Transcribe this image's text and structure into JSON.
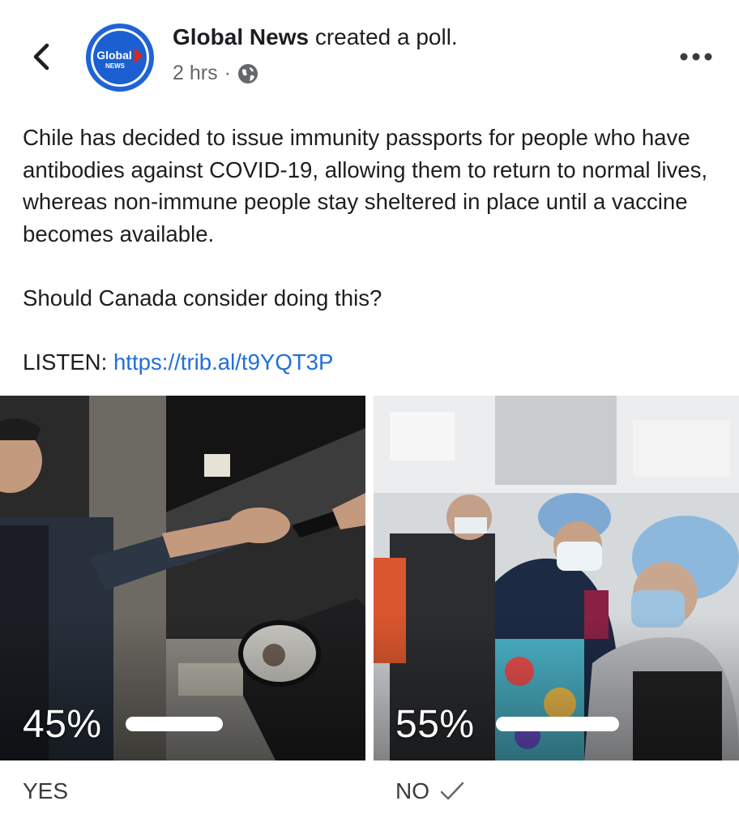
{
  "post": {
    "page_name": "Global News",
    "action_text": " created a poll.",
    "time": "2 hrs",
    "separator": "·",
    "avatar": {
      "logo_line1": "Global",
      "logo_line2": "NEWS",
      "ring_color": "#1f63d6",
      "arrow_color": "#e2231a"
    },
    "body": {
      "paragraph1": "Chile has decided to issue immunity passports for people who have antibodies against COVID-19, allowing them to return to normal lives, whereas non-immune people stay sheltered in place until a vaccine becomes available.",
      "paragraph2": "Should Canada consider doing this?",
      "listen_label": "LISTEN: ",
      "listen_link": "https://trib.al/t9YQT3P"
    }
  },
  "poll": {
    "options": [
      {
        "label": "YES",
        "percent_text": "45%",
        "percent": 45,
        "selected": false
      },
      {
        "label": "NO",
        "percent_text": "55%",
        "percent": 55,
        "selected": true
      }
    ]
  },
  "icons": {
    "back": "chevron-left-icon",
    "more": "more-horizontal-icon",
    "audience": "globe-icon",
    "selected": "checkmark-icon"
  },
  "colors": {
    "link": "#216fdb",
    "muted": "#65676b",
    "text": "#1c1e21"
  }
}
